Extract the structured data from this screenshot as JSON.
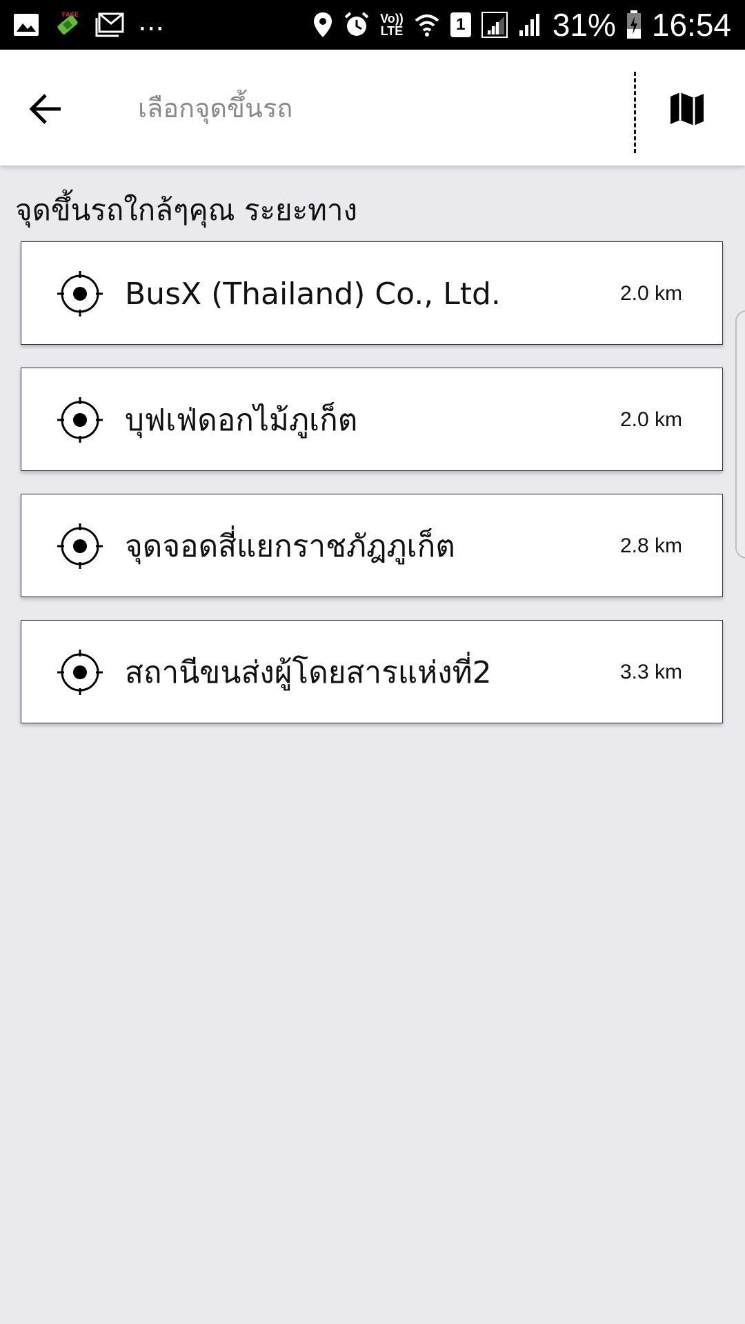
{
  "status_bar": {
    "battery_percent": "31%",
    "time": "16:54",
    "overflow": "...",
    "network": [
      "Vo))",
      "LTE"
    ],
    "sim_slot": "1",
    "left_icons": [
      "gallery-icon",
      "fake-gps-icon",
      "gmail-icon"
    ],
    "right_icons": [
      "location-icon",
      "alarm-icon",
      "volte-icon",
      "wifi-icon",
      "sim-1-icon",
      "signal-icon",
      "signal-icon",
      "battery-charging-icon"
    ]
  },
  "appbar": {
    "back_icon": "arrow-left-icon",
    "search_placeholder": "เลือกจุดขึ้นรถ",
    "map_icon": "map-icon"
  },
  "section": {
    "title": "จุดขึ้นรถใกล้ๆคุณ ระยะทาง"
  },
  "pickup_points": [
    {
      "name": "BusX (Thailand) Co., Ltd.",
      "distance": "2.0 km",
      "icon": "crosshair-location-icon"
    },
    {
      "name": "บุฟเฟ่ดอกไม้ภูเก็ต",
      "distance": "2.0 km",
      "icon": "crosshair-location-icon"
    },
    {
      "name": "จุดจอดสี่แยกราชภัฎภูเก็ต",
      "distance": "2.8 km",
      "icon": "crosshair-location-icon"
    },
    {
      "name": "สถานีขนส่งผู้โดยสารแห่งที่2",
      "distance": "3.3 km",
      "icon": "crosshair-location-icon"
    }
  ],
  "colors": {
    "background": "#e9e9ee",
    "card": "#ffffff",
    "status_bar": "#000000",
    "text": "#111111"
  }
}
